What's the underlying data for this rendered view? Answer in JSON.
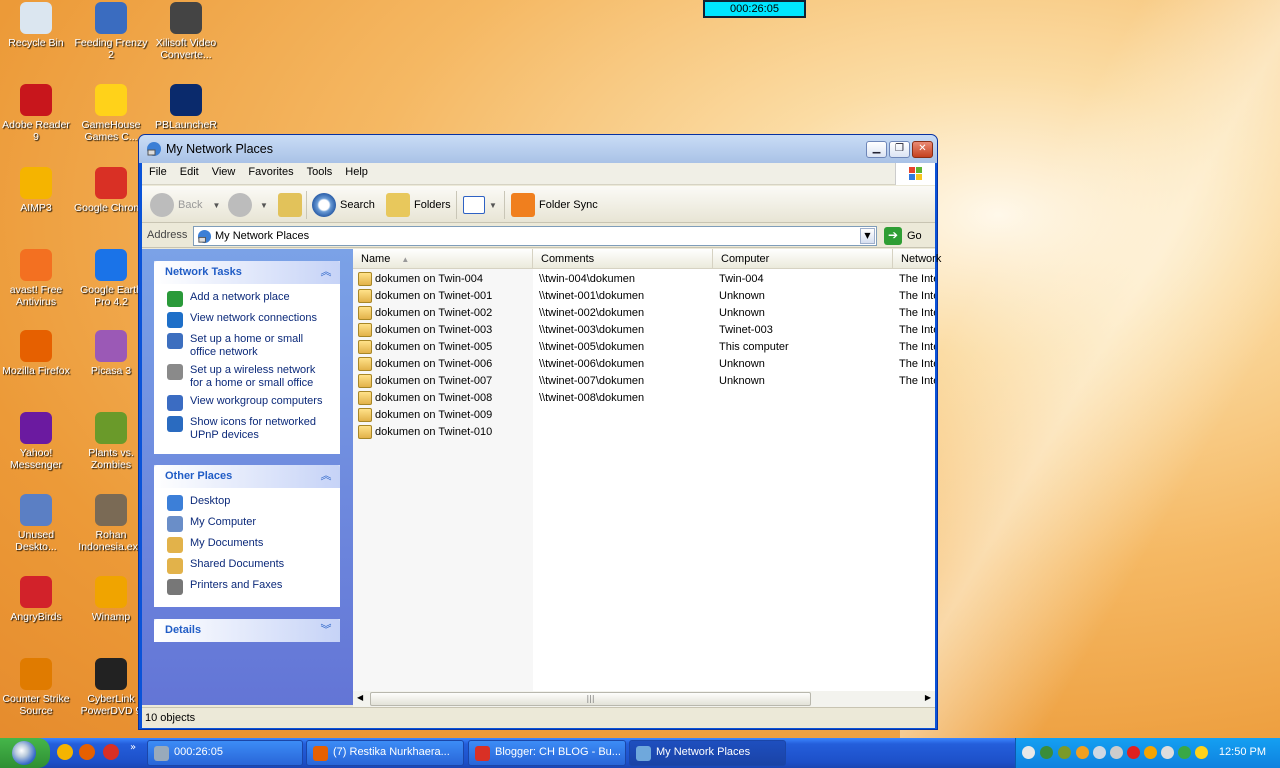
{
  "desktop": {
    "icons": [
      {
        "label": "Recycle Bin",
        "color": "#dbe6f0"
      },
      {
        "label": "Feeding Frenzy 2",
        "color": "#3a6cc0"
      },
      {
        "label": "Xilisoft Video Converte...",
        "color": "#444"
      },
      {
        "label": "Adobe Reader 9",
        "color": "#c8161c"
      },
      {
        "label": "GameHouse Games C...",
        "color": "#ffd21a"
      },
      {
        "label": "PBLauncheR",
        "color": "#0a2a6c"
      },
      {
        "label": "AIMP3",
        "color": "#f5b400"
      },
      {
        "label": "Google Chrome",
        "color": "#d93025"
      },
      {
        "label": "avast! Free Antivirus",
        "color": "#f37021"
      },
      {
        "label": "Google Earth Pro 4.2",
        "color": "#1a73e8"
      },
      {
        "label": "Mozilla Firefox",
        "color": "#e66000"
      },
      {
        "label": "Picasa 3",
        "color": "#9b59b6"
      },
      {
        "label": "Yahoo! Messenger",
        "color": "#6b1aa0"
      },
      {
        "label": "Plants vs. Zombies",
        "color": "#6a9a2a"
      },
      {
        "label": "Unused Deskto...",
        "color": "#5b7fc4"
      },
      {
        "label": "Rohan Indonesia.exe",
        "color": "#7a6a55"
      },
      {
        "label": "AngryBirds",
        "color": "#d2222a"
      },
      {
        "label": "Winamp",
        "color": "#f0a400"
      },
      {
        "label": "Counter Strike Source",
        "color": "#e07b00"
      },
      {
        "label": "CyberLink PowerDVD 9",
        "color": "#222"
      }
    ],
    "timer": "000:26:05"
  },
  "window": {
    "title": "My Network Places",
    "menu": [
      "File",
      "Edit",
      "View",
      "Favorites",
      "Tools",
      "Help"
    ],
    "toolbar": {
      "back": "Back",
      "search": "Search",
      "folders": "Folders",
      "folder_sync": "Folder Sync"
    },
    "address": {
      "label": "Address",
      "value": "My Network Places",
      "go": "Go"
    },
    "network_tasks": {
      "title": "Network Tasks",
      "items": [
        "Add a network place",
        "View network connections",
        "Set up a home or small office network",
        "Set up a wireless network for a home or small office",
        "View workgroup computers",
        "Show icons for networked UPnP devices"
      ]
    },
    "other_places": {
      "title": "Other Places",
      "items": [
        "Desktop",
        "My Computer",
        "My Documents",
        "Shared Documents",
        "Printers and Faxes"
      ]
    },
    "details": {
      "title": "Details"
    },
    "columns": [
      "Name",
      "Comments",
      "Computer",
      "Network"
    ],
    "rows": [
      {
        "name": "dokumen on Twin-004",
        "comment": "\\\\twin-004\\dokumen",
        "computer": "Twin-004",
        "network": "The Inte"
      },
      {
        "name": "dokumen on Twinet-001",
        "comment": "\\\\twinet-001\\dokumen",
        "computer": "Unknown",
        "network": "The Inte"
      },
      {
        "name": "dokumen on Twinet-002",
        "comment": "\\\\twinet-002\\dokumen",
        "computer": "Unknown",
        "network": "The Inte"
      },
      {
        "name": "dokumen on Twinet-003",
        "comment": "\\\\twinet-003\\dokumen",
        "computer": "Twinet-003",
        "network": "The Inte"
      },
      {
        "name": "dokumen on Twinet-005",
        "comment": "\\\\twinet-005\\dokumen",
        "computer": "This computer",
        "network": "The Inte"
      },
      {
        "name": "dokumen on Twinet-006",
        "comment": "\\\\twinet-006\\dokumen",
        "computer": "Unknown",
        "network": "The Inte"
      },
      {
        "name": "dokumen on Twinet-007",
        "comment": "\\\\twinet-007\\dokumen",
        "computer": "Unknown",
        "network": "The Inte"
      },
      {
        "name": "dokumen on Twinet-008",
        "comment": "\\\\twinet-008\\dokumen",
        "computer": "",
        "network": ""
      },
      {
        "name": "dokumen on Twinet-009",
        "comment": "",
        "computer": "",
        "network": ""
      },
      {
        "name": "dokumen on Twinet-010",
        "comment": "",
        "computer": "",
        "network": ""
      }
    ],
    "status": "10 objects"
  },
  "taskbar": {
    "tasks": [
      {
        "label": "000:26:05",
        "color": "#9ab"
      },
      {
        "label": "(7) Restika Nurkhaera...",
        "color": "#e66000"
      },
      {
        "label": "Blogger: CH BLOG - Bu...",
        "color": "#d93025"
      },
      {
        "label": "My Network Places",
        "color": "#6fa8dc"
      }
    ],
    "clock": "12:50 PM"
  }
}
